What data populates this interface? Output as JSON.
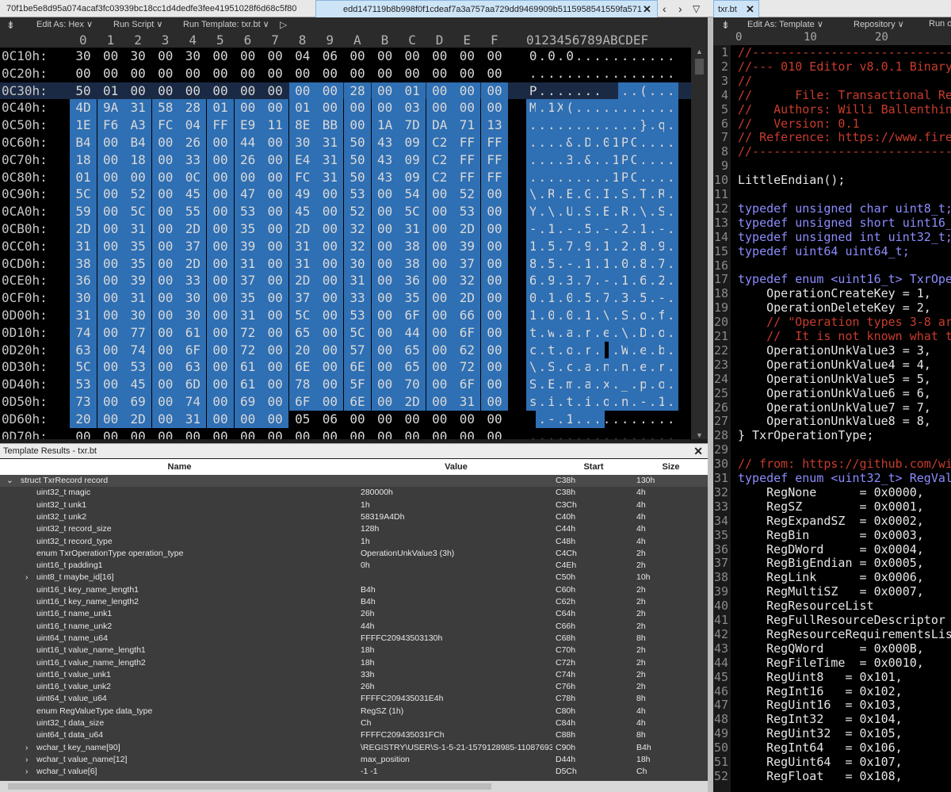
{
  "tabs": [
    {
      "label": "70f1be5e8d95a074acaf3fc03939bc18cc1d4dedfe3fee41951028f6d68c5f80"
    },
    {
      "label": "edd147119b8b998f0f1cdeaf7a3a757aa729dd9469909b5115958541559fa571"
    },
    {
      "label": "txr.bt"
    }
  ],
  "hex_toolbar": {
    "edit_as": "Edit As: Hex ∨",
    "run_script": "Run Script ∨",
    "run_template": "Run Template: txr.bt ∨"
  },
  "col_headers": [
    "0",
    "1",
    "2",
    "3",
    "4",
    "5",
    "6",
    "7",
    "8",
    "9",
    "A",
    "B",
    "C",
    "D",
    "E",
    "F"
  ],
  "ascii_header": "0123456789ABCDEF",
  "hex_rows": [
    {
      "off": "0C10h:",
      "bytes": [
        "30",
        "00",
        "30",
        "00",
        "30",
        "00",
        "00",
        "00",
        "04",
        "06",
        "00",
        "00",
        "00",
        "00",
        "00",
        "00"
      ],
      "ascii": "0.0.0..........."
    },
    {
      "off": "0C20h:",
      "bytes": [
        "00",
        "00",
        "00",
        "00",
        "00",
        "00",
        "00",
        "00",
        "00",
        "00",
        "00",
        "00",
        "00",
        "00",
        "00",
        "00"
      ],
      "ascii": "................"
    },
    {
      "off": "0C30h:",
      "bytes": [
        "50",
        "01",
        "00",
        "00",
        "00",
        "00",
        "00",
        "00",
        "00",
        "00",
        "28",
        "00",
        "01",
        "00",
        "00",
        "00"
      ],
      "ascii": "P.......  ..(....."
    },
    {
      "off": "0C40h:",
      "bytes": [
        "4D",
        "9A",
        "31",
        "58",
        "28",
        "01",
        "00",
        "00",
        "01",
        "00",
        "00",
        "00",
        "03",
        "00",
        "00",
        "00"
      ],
      "ascii": "M.1X(..........."
    },
    {
      "off": "0C50h:",
      "bytes": [
        "1E",
        "F6",
        "A3",
        "FC",
        "04",
        "FF",
        "E9",
        "11",
        "8E",
        "BB",
        "00",
        "1A",
        "7D",
        "DA",
        "71",
        "13"
      ],
      "ascii": "............}.q."
    },
    {
      "off": "0C60h:",
      "bytes": [
        "B4",
        "00",
        "B4",
        "00",
        "26",
        "00",
        "44",
        "00",
        "30",
        "31",
        "50",
        "43",
        "09",
        "C2",
        "FF",
        "FF"
      ],
      "ascii": "....&.D.01PC...."
    },
    {
      "off": "0C70h:",
      "bytes": [
        "18",
        "00",
        "18",
        "00",
        "33",
        "00",
        "26",
        "00",
        "E4",
        "31",
        "50",
        "43",
        "09",
        "C2",
        "FF",
        "FF"
      ],
      "ascii": "....3.&..1PC...."
    },
    {
      "off": "0C80h:",
      "bytes": [
        "01",
        "00",
        "00",
        "00",
        "0C",
        "00",
        "00",
        "00",
        "FC",
        "31",
        "50",
        "43",
        "09",
        "C2",
        "FF",
        "FF"
      ],
      "ascii": ".........1PC...."
    },
    {
      "off": "0C90h:",
      "bytes": [
        "5C",
        "00",
        "52",
        "00",
        "45",
        "00",
        "47",
        "00",
        "49",
        "00",
        "53",
        "00",
        "54",
        "00",
        "52",
        "00"
      ],
      "ascii": "\\.R.E.G.I.S.T.R."
    },
    {
      "off": "0CA0h:",
      "bytes": [
        "59",
        "00",
        "5C",
        "00",
        "55",
        "00",
        "53",
        "00",
        "45",
        "00",
        "52",
        "00",
        "5C",
        "00",
        "53",
        "00"
      ],
      "ascii": "Y.\\.U.S.E.R.\\.S."
    },
    {
      "off": "0CB0h:",
      "bytes": [
        "2D",
        "00",
        "31",
        "00",
        "2D",
        "00",
        "35",
        "00",
        "2D",
        "00",
        "32",
        "00",
        "31",
        "00",
        "2D",
        "00"
      ],
      "ascii": "-.1.-.5.-.2.1.-."
    },
    {
      "off": "0CC0h:",
      "bytes": [
        "31",
        "00",
        "35",
        "00",
        "37",
        "00",
        "39",
        "00",
        "31",
        "00",
        "32",
        "00",
        "38",
        "00",
        "39",
        "00"
      ],
      "ascii": "1.5.7.9.1.2.8.9."
    },
    {
      "off": "0CD0h:",
      "bytes": [
        "38",
        "00",
        "35",
        "00",
        "2D",
        "00",
        "31",
        "00",
        "31",
        "00",
        "30",
        "00",
        "38",
        "00",
        "37",
        "00"
      ],
      "ascii": "8.5.-.1.1.0.8.7."
    },
    {
      "off": "0CE0h:",
      "bytes": [
        "36",
        "00",
        "39",
        "00",
        "33",
        "00",
        "37",
        "00",
        "2D",
        "00",
        "31",
        "00",
        "36",
        "00",
        "32",
        "00"
      ],
      "ascii": "6.9.3.7.-.1.6.2."
    },
    {
      "off": "0CF0h:",
      "bytes": [
        "30",
        "00",
        "31",
        "00",
        "30",
        "00",
        "35",
        "00",
        "37",
        "00",
        "33",
        "00",
        "35",
        "00",
        "2D",
        "00"
      ],
      "ascii": "0.1.0.5.7.3.5.-."
    },
    {
      "off": "0D00h:",
      "bytes": [
        "31",
        "00",
        "30",
        "00",
        "30",
        "00",
        "31",
        "00",
        "5C",
        "00",
        "53",
        "00",
        "6F",
        "00",
        "66",
        "00"
      ],
      "ascii": "1.0.0.1.\\.S.o.f."
    },
    {
      "off": "0D10h:",
      "bytes": [
        "74",
        "00",
        "77",
        "00",
        "61",
        "00",
        "72",
        "00",
        "65",
        "00",
        "5C",
        "00",
        "44",
        "00",
        "6F",
        "00"
      ],
      "ascii": "t.w.a.r.e.\\.D.o."
    },
    {
      "off": "0D20h:",
      "bytes": [
        "63",
        "00",
        "74",
        "00",
        "6F",
        "00",
        "72",
        "00",
        "20",
        "00",
        "57",
        "00",
        "65",
        "00",
        "62",
        "00"
      ],
      "ascii": "c.t.o.r. .W.e.b."
    },
    {
      "off": "0D30h:",
      "bytes": [
        "5C",
        "00",
        "53",
        "00",
        "63",
        "00",
        "61",
        "00",
        "6E",
        "00",
        "6E",
        "00",
        "65",
        "00",
        "72",
        "00"
      ],
      "ascii": "\\.S.c.a.n.n.e.r."
    },
    {
      "off": "0D40h:",
      "bytes": [
        "53",
        "00",
        "45",
        "00",
        "6D",
        "00",
        "61",
        "00",
        "78",
        "00",
        "5F",
        "00",
        "70",
        "00",
        "6F",
        "00"
      ],
      "ascii": "S.E.m.a.x._.p.o."
    },
    {
      "off": "0D50h:",
      "bytes": [
        "73",
        "00",
        "69",
        "00",
        "74",
        "00",
        "69",
        "00",
        "6F",
        "00",
        "6E",
        "00",
        "2D",
        "00",
        "31",
        "00"
      ],
      "ascii": "s.i.t.i.o.n.-.1."
    },
    {
      "off": "0D60h:",
      "bytes": [
        "20",
        "00",
        "2D",
        "00",
        "31",
        "00",
        "00",
        "00",
        "05",
        "06",
        "00",
        "00",
        "00",
        "00",
        "00",
        "00"
      ],
      "ascii": " .-.1..........."
    },
    {
      "off": "0D70h:",
      "bytes": [
        "00",
        "00",
        "00",
        "00",
        "00",
        "00",
        "00",
        "00",
        "00",
        "00",
        "00",
        "00",
        "00",
        "00",
        "00",
        "00"
      ],
      "ascii": "................"
    }
  ],
  "template_panel": {
    "title": "Template Results - txr.bt",
    "col_name": "Name",
    "col_value": "Value",
    "col_start": "Start",
    "col_size": "Size"
  },
  "template_rows": [
    {
      "name": "struct TxrRecord record",
      "value": "",
      "start": "C38h",
      "size": "130h"
    },
    {
      "name": "uint32_t magic",
      "value": "280000h",
      "start": "C38h",
      "size": "4h"
    },
    {
      "name": "uint32_t unk1",
      "value": "1h",
      "start": "C3Ch",
      "size": "4h"
    },
    {
      "name": "uint32_t unk2",
      "value": "58319A4Dh",
      "start": "C40h",
      "size": "4h"
    },
    {
      "name": "uint32_t record_size",
      "value": "128h",
      "start": "C44h",
      "size": "4h"
    },
    {
      "name": "uint32_t record_type",
      "value": "1h",
      "start": "C48h",
      "size": "4h"
    },
    {
      "name": "enum TxrOperationType operation_type",
      "value": "OperationUnkValue3 (3h)",
      "start": "C4Ch",
      "size": "2h"
    },
    {
      "name": "uint16_t padding1",
      "value": "0h",
      "start": "C4Eh",
      "size": "2h"
    },
    {
      "name": "uint8_t maybe_id[16]",
      "value": "",
      "start": "C50h",
      "size": "10h"
    },
    {
      "name": "uint16_t key_name_length1",
      "value": "B4h",
      "start": "C60h",
      "size": "2h"
    },
    {
      "name": "uint16_t key_name_length2",
      "value": "B4h",
      "start": "C62h",
      "size": "2h"
    },
    {
      "name": "uint16_t name_unk1",
      "value": "26h",
      "start": "C64h",
      "size": "2h"
    },
    {
      "name": "uint16_t name_unk2",
      "value": "44h",
      "start": "C66h",
      "size": "2h"
    },
    {
      "name": "uint64_t name_u64",
      "value": "FFFFC20943503130h",
      "start": "C68h",
      "size": "8h"
    },
    {
      "name": "uint16_t value_name_length1",
      "value": "18h",
      "start": "C70h",
      "size": "2h"
    },
    {
      "name": "uint16_t value_name_length2",
      "value": "18h",
      "start": "C72h",
      "size": "2h"
    },
    {
      "name": "uint16_t value_unk1",
      "value": "33h",
      "start": "C74h",
      "size": "2h"
    },
    {
      "name": "uint16_t value_unk2",
      "value": "26h",
      "start": "C76h",
      "size": "2h"
    },
    {
      "name": "uint64_t value_u64",
      "value": "FFFFC209435031E4h",
      "start": "C78h",
      "size": "8h"
    },
    {
      "name": "enum RegValueType data_type",
      "value": "RegSZ (1h)",
      "start": "C80h",
      "size": "4h"
    },
    {
      "name": "uint32_t data_size",
      "value": "Ch",
      "start": "C84h",
      "size": "4h"
    },
    {
      "name": "uint64_t data_u64",
      "value": "FFFFC209435031FCh",
      "start": "C88h",
      "size": "8h"
    },
    {
      "name": "wchar_t key_name[90]",
      "value": "\\REGISTRY\\USER\\S-1-5-21-1579128985-110876937-1",
      "start": "C90h",
      "size": "B4h"
    },
    {
      "name": "wchar_t value_name[12]",
      "value": "max_position",
      "start": "D44h",
      "size": "18h"
    },
    {
      "name": "wchar_t value[6]",
      "value": "-1 -1",
      "start": "D5Ch",
      "size": "Ch"
    }
  ],
  "right_toolbar": {
    "edit_as": "Edit As: Template ∨",
    "repository": "Repository ∨",
    "run": "Run o"
  },
  "ruler": {
    "m0": "0",
    "m10": "10",
    "m20": "20"
  },
  "code_lines": [
    {
      "n": "1",
      "t": "//------------------------------------------"
    },
    {
      "n": "2",
      "t": "//--- 010 Editor v8.0.1 Binary Template"
    },
    {
      "n": "3",
      "t": "//"
    },
    {
      "n": "4",
      "t": "//      File: Transactional Registry"
    },
    {
      "n": "5",
      "t": "//   Authors: Willi Ballenthin"
    },
    {
      "n": "6",
      "t": "//   Version: 0.1"
    },
    {
      "n": "7",
      "t": "// Reference: https://www.fireeye.com"
    },
    {
      "n": "8",
      "t": "//------------------------------------------"
    },
    {
      "n": "9",
      "t": ""
    },
    {
      "n": "10",
      "t": "LittleEndian();"
    },
    {
      "n": "11",
      "t": ""
    },
    {
      "n": "12",
      "t": "typedef unsigned char uint8_t;"
    },
    {
      "n": "13",
      "t": "typedef unsigned short uint16_t;"
    },
    {
      "n": "14",
      "t": "typedef unsigned int uint32_t;"
    },
    {
      "n": "15",
      "t": "typedef uint64 uint64_t;"
    },
    {
      "n": "16",
      "t": ""
    },
    {
      "n": "17",
      "t": "typedef enum <uint16_t> TxrOperationType {"
    },
    {
      "n": "18",
      "t": "    OperationCreateKey = 1,"
    },
    {
      "n": "19",
      "t": "    OperationDeleteKey = 2,"
    },
    {
      "n": "20",
      "t": "    // \"Operation types 3-8 are ..."
    },
    {
      "n": "21",
      "t": "    //  It is not known what they"
    },
    {
      "n": "22",
      "t": "    OperationUnkValue3 = 3,"
    },
    {
      "n": "23",
      "t": "    OperationUnkValue4 = 4,"
    },
    {
      "n": "24",
      "t": "    OperationUnkValue5 = 5,"
    },
    {
      "n": "25",
      "t": "    OperationUnkValue6 = 6,"
    },
    {
      "n": "26",
      "t": "    OperationUnkValue7 = 7,"
    },
    {
      "n": "27",
      "t": "    OperationUnkValue8 = 8,"
    },
    {
      "n": "28",
      "t": "} TxrOperationType;"
    },
    {
      "n": "29",
      "t": ""
    },
    {
      "n": "30",
      "t": "// from: https://github.com/williballenthin"
    },
    {
      "n": "31",
      "t": "typedef enum <uint32_t> RegValueType {"
    },
    {
      "n": "32",
      "t": "    RegNone      = 0x0000,"
    },
    {
      "n": "33",
      "t": "    RegSZ        = 0x0001,"
    },
    {
      "n": "34",
      "t": "    RegExpandSZ  = 0x0002,"
    },
    {
      "n": "35",
      "t": "    RegBin       = 0x0003,"
    },
    {
      "n": "36",
      "t": "    RegDWord     = 0x0004,"
    },
    {
      "n": "37",
      "t": "    RegBigEndian = 0x0005,"
    },
    {
      "n": "38",
      "t": "    RegLink      = 0x0006,"
    },
    {
      "n": "39",
      "t": "    RegMultiSZ   = 0x0007,"
    },
    {
      "n": "40",
      "t": "    RegResourceList"
    },
    {
      "n": "41",
      "t": "    RegFullResourceDescriptor"
    },
    {
      "n": "42",
      "t": "    RegResourceRequirementsList"
    },
    {
      "n": "43",
      "t": "    RegQWord     = 0x000B,"
    },
    {
      "n": "44",
      "t": "    RegFileTime  = 0x0010,"
    },
    {
      "n": "45",
      "t": "    RegUint8   = 0x101,"
    },
    {
      "n": "46",
      "t": "    RegInt16   = 0x102,"
    },
    {
      "n": "47",
      "t": "    RegUint16  = 0x103,"
    },
    {
      "n": "48",
      "t": "    RegInt32   = 0x104,"
    },
    {
      "n": "49",
      "t": "    RegUint32  = 0x105,"
    },
    {
      "n": "50",
      "t": "    RegInt64   = 0x106,"
    },
    {
      "n": "51",
      "t": "    RegUint64  = 0x107,"
    },
    {
      "n": "52",
      "t": "    RegFloat   = 0x108,"
    }
  ]
}
